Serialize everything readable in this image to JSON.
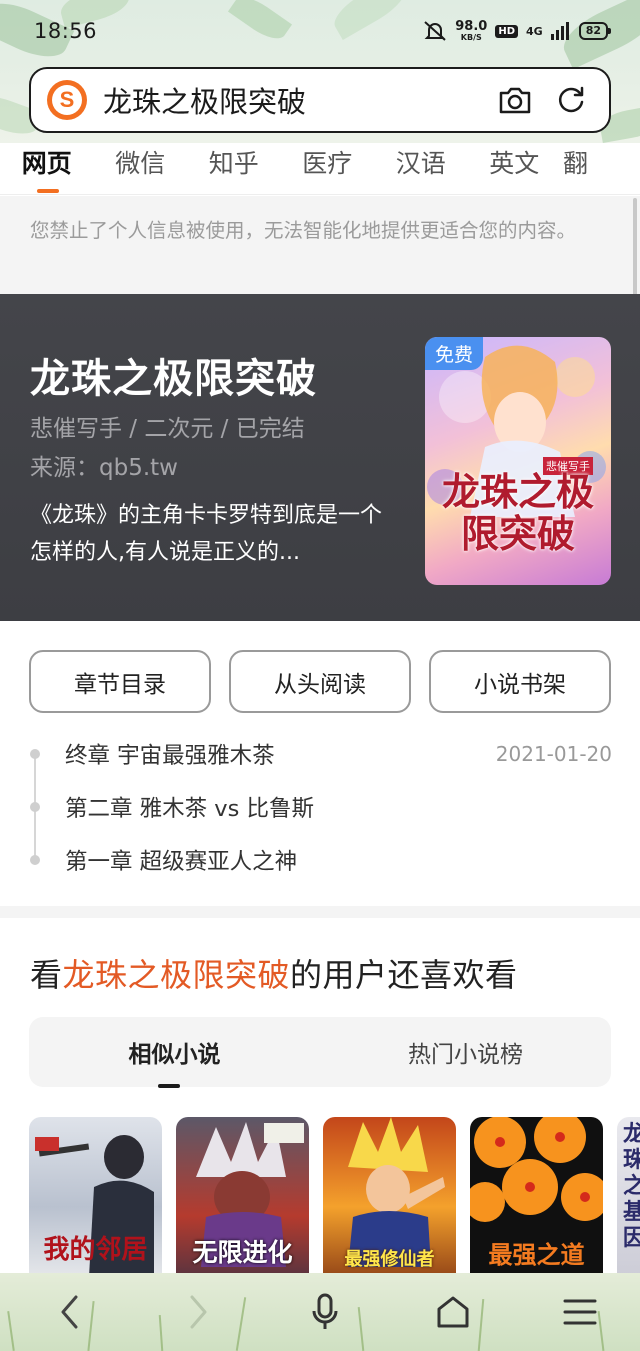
{
  "status_bar": {
    "time": "18:56",
    "net_speed_value": "98.0",
    "net_speed_unit": "KB/S",
    "hd_label": "HD",
    "network": "4G",
    "battery": "82"
  },
  "search": {
    "query": "龙珠之极限突破",
    "logo_letter": "S"
  },
  "tabs": [
    "网页",
    "微信",
    "知乎",
    "医疗",
    "汉语",
    "英文",
    "翻"
  ],
  "notice": "您禁止了个人信息被使用，无法智能化地提供更适合您的内容。",
  "book": {
    "title": "龙珠之极限突破",
    "meta": "悲催写手 / 二次元 / 已完结",
    "source": "来源：qb5.tw",
    "description": "《龙珠》的主角卡卡罗特到底是一个怎样的人,有人说是正义的...",
    "badge": "免费",
    "cover_title": "龙珠之极限突破",
    "cover_author": "悲催写手"
  },
  "actions": {
    "toc": "章节目录",
    "read_from_start": "从头阅读",
    "bookshelf": "小说书架"
  },
  "chapters": [
    {
      "title": "终章 宇宙最强雅木茶",
      "date": "2021-01-20"
    },
    {
      "title": "第二章 雅木茶 vs 比鲁斯",
      "date": ""
    },
    {
      "title": "第一章 超级赛亚人之神",
      "date": ""
    }
  ],
  "recommendations": {
    "prefix": "看",
    "highlight": "龙珠之极限突破",
    "suffix": "的用户还喜欢看",
    "tabs": [
      "相似小说",
      "热门小说榜"
    ],
    "covers": [
      {
        "title": "我的邻居"
      },
      {
        "title": "无限进化"
      },
      {
        "title": "最强修仙者"
      },
      {
        "title": "最强之道"
      },
      {
        "title": "龙珠之基因"
      }
    ]
  },
  "bottom_nav": {
    "back_icon": "chevron-left-icon",
    "forward_icon": "chevron-right-icon",
    "voice_icon": "microphone-icon",
    "home_icon": "home-icon",
    "menu_icon": "menu-icon"
  },
  "colors": {
    "accent": "#f36f21",
    "highlight": "#e35a25",
    "card_bg": "#44454a",
    "badge": "#4a90f0"
  }
}
